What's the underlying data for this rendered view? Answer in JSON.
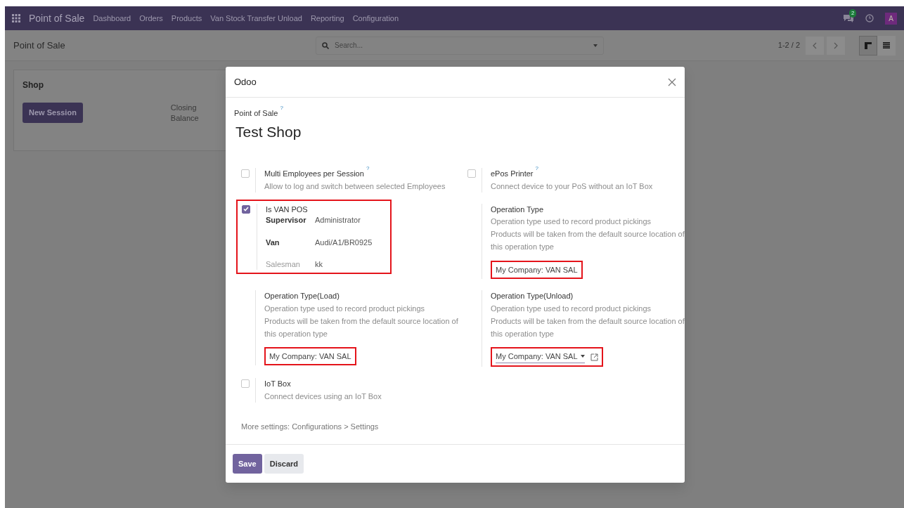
{
  "navbar": {
    "app": "Point of Sale",
    "menu": [
      "Dashboard",
      "Orders",
      "Products",
      "Van Stock Transfer Unload",
      "Reporting",
      "Configuration"
    ],
    "chat_badge": "2",
    "avatar": "A"
  },
  "control_panel": {
    "breadcrumb": "Point of Sale",
    "search": {
      "placeholder": "Search..."
    },
    "pager": "1-2 / 2",
    "views": [
      {
        "kind": "kanban",
        "selected": true
      },
      {
        "kind": "list",
        "selected": false
      }
    ]
  },
  "kanban": [
    {
      "title": "Shop",
      "button": "New Session",
      "info_label": "Closing Balance"
    }
  ],
  "dialog": {
    "title": "Odoo",
    "name_label": "Point of Sale",
    "name_label_help": "?",
    "name": "Test Shop",
    "settings": [
      {
        "kind": "checkbox",
        "checked": false,
        "highlighted": false,
        "title": "Multi Employees per Session",
        "help": "?",
        "description": [
          "Allow to log and switch between selected Employees"
        ]
      },
      {
        "kind": "checkbox",
        "checked": false,
        "highlighted": false,
        "title": "ePos Printer",
        "help": "?",
        "description": [
          "Connect device to your PoS without an IoT Box"
        ]
      },
      {
        "kind": "checkbox",
        "checked": true,
        "highlighted": true,
        "title": "Is VAN POS",
        "fields": [
          {
            "label": "Supervisor",
            "value": "Administrator",
            "required": true
          },
          {
            "label": "Van",
            "value": "Audi/A1/BR0925",
            "required": true
          },
          {
            "label": "Salesman",
            "value": "kk",
            "required": false
          }
        ]
      },
      {
        "kind": "field",
        "title": "Operation Type",
        "description": [
          "Operation type used to record product pickings",
          "Products will be taken from the default source location of this operation type"
        ],
        "value": "My Company: VAN SAL",
        "highlighted": true,
        "dropdown": false,
        "external_link": false
      },
      {
        "kind": "field",
        "title": "Operation Type(Load)",
        "description": [
          "Operation type used to record product pickings",
          "Products will be taken from the default source location of this operation type"
        ],
        "value": "My Company: VAN SAL",
        "highlighted": true,
        "dropdown": false,
        "external_link": false
      },
      {
        "kind": "field",
        "title": "Operation Type(Unload)",
        "description": [
          "Operation type used to record product pickings",
          "Products will be taken from the default source location of this operation type"
        ],
        "value": "My Company: VAN SAL",
        "highlighted": true,
        "dropdown": true,
        "external_link": true
      },
      {
        "kind": "checkbox",
        "checked": false,
        "highlighted": false,
        "title": "IoT Box",
        "description": [
          "Connect devices using an IoT Box"
        ]
      }
    ],
    "more_settings": {
      "label": "More settings:",
      "link": "Configurations > Settings"
    },
    "buttons": [
      {
        "label": "Save",
        "kind": "primary"
      },
      {
        "label": "Discard",
        "kind": "secondary"
      }
    ]
  }
}
